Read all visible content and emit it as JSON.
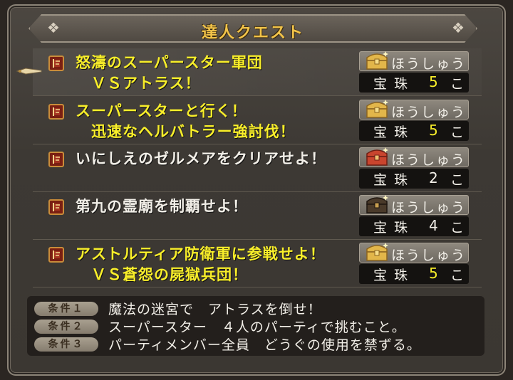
{
  "window": {
    "title": "達人クエスト"
  },
  "quests": [
    {
      "title_line1": "怒濤のスーパースター軍団",
      "title_line2": "　ＶＳアトラス！",
      "color": "#f8ee2a",
      "reward_label": "ほうしゅう",
      "reward_item": "宝珠",
      "reward_count": "5",
      "reward_unit": "こ",
      "count_color": "#f8ee2a",
      "chest": "gold-chest-icon"
    },
    {
      "title_line1": "スーパースターと行く！",
      "title_line2": "　迅速なヘルバトラー強討伐！",
      "color": "#f8ee2a",
      "reward_label": "ほうしゅう",
      "reward_item": "宝珠",
      "reward_count": "5",
      "reward_unit": "こ",
      "count_color": "#f8ee2a",
      "chest": "gold-chest-icon"
    },
    {
      "title_line1": "いにしえのゼルメアをクリアせよ！",
      "title_line2": "",
      "color": "#f2efe8",
      "reward_label": "ほうしゅう",
      "reward_item": "宝珠",
      "reward_count": "2",
      "reward_unit": "こ",
      "count_color": "#f2efe8",
      "chest": "red-chest-icon"
    },
    {
      "title_line1": "第九の霊廟を制覇せよ！",
      "title_line2": "",
      "color": "#f2efe8",
      "reward_label": "ほうしゅう",
      "reward_item": "宝珠",
      "reward_count": "4",
      "reward_unit": "こ",
      "count_color": "#f2efe8",
      "chest": "dark-chest-icon"
    },
    {
      "title_line1": "アストルティア防衛軍に参戦せよ！",
      "title_line2": "　ＶＳ蒼怨の屍獄兵団！",
      "color": "#f8ee2a",
      "reward_label": "ほうしゅう",
      "reward_item": "宝珠",
      "reward_count": "5",
      "reward_unit": "こ",
      "count_color": "#f8ee2a",
      "chest": "gold-chest-icon"
    }
  ],
  "conditions": [
    {
      "tag": "条件１",
      "text": "魔法の迷宮で　アトラスを倒せ！"
    },
    {
      "tag": "条件２",
      "text": "スーパースター　４人のパーティで挑むこと。"
    },
    {
      "tag": "条件３",
      "text": "パーティメンバー全員　どうぐの使用を禁ずる。"
    }
  ],
  "colors": {
    "title": "#f2c44a",
    "highlight_text": "#f8ee2a",
    "normal_text": "#f2efe8"
  }
}
